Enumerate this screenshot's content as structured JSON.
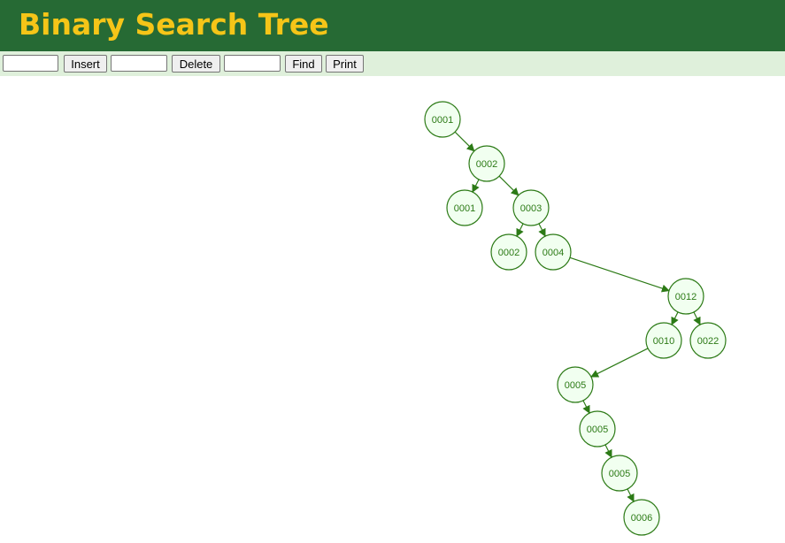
{
  "header": {
    "title": "Binary Search Tree"
  },
  "toolbar": {
    "insert_value": "",
    "insert_label": "Insert",
    "delete_value": "",
    "delete_label": "Delete",
    "find_value": "",
    "find_label": "Find",
    "print_label": "Print"
  },
  "colors": {
    "header_bg": "#266a34",
    "title": "#f5c518",
    "toolbar_bg": "#dff0db",
    "node_fill": "#f1fff0",
    "node_stroke": "#2c7a16"
  },
  "tree": {
    "nodes": [
      {
        "id": "n1",
        "label": "0001"
      },
      {
        "id": "n2",
        "label": "0002"
      },
      {
        "id": "n3",
        "label": "0001"
      },
      {
        "id": "n4",
        "label": "0003"
      },
      {
        "id": "n5",
        "label": "0002"
      },
      {
        "id": "n6",
        "label": "0004"
      },
      {
        "id": "n7",
        "label": "0012"
      },
      {
        "id": "n8",
        "label": "0010"
      },
      {
        "id": "n9",
        "label": "0022"
      },
      {
        "id": "n10",
        "label": "0005"
      },
      {
        "id": "n11",
        "label": "0005"
      },
      {
        "id": "n12",
        "label": "0005"
      },
      {
        "id": "n13",
        "label": "0006"
      }
    ],
    "edges": [
      {
        "from": "n1",
        "to": "n2"
      },
      {
        "from": "n2",
        "to": "n3"
      },
      {
        "from": "n2",
        "to": "n4"
      },
      {
        "from": "n4",
        "to": "n5"
      },
      {
        "from": "n4",
        "to": "n6"
      },
      {
        "from": "n6",
        "to": "n7"
      },
      {
        "from": "n7",
        "to": "n8"
      },
      {
        "from": "n7",
        "to": "n9"
      },
      {
        "from": "n8",
        "to": "n10"
      },
      {
        "from": "n10",
        "to": "n11"
      },
      {
        "from": "n11",
        "to": "n12"
      },
      {
        "from": "n12",
        "to": "n13"
      }
    ]
  }
}
